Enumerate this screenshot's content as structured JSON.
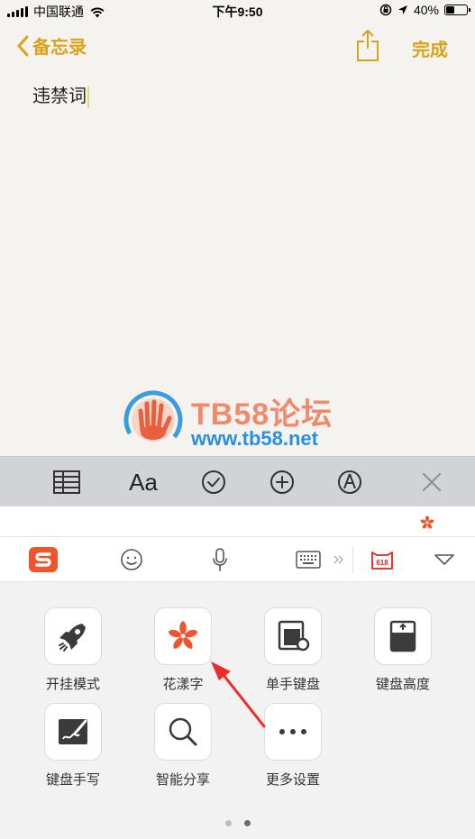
{
  "status": {
    "carrier": "中国联通",
    "time": "下午9:50",
    "battery": "40%"
  },
  "nav": {
    "back_label": "备忘录",
    "done_label": "完成"
  },
  "note": {
    "text": "违禁词"
  },
  "watermark": {
    "title": "TB58论坛",
    "url": "www.tb58.net"
  },
  "format_toolbar": {
    "text_style_label": "Aa"
  },
  "keyboard_toolbar": {
    "badge_label": "618"
  },
  "panel": {
    "tiles": [
      {
        "label": "开挂模式",
        "icon": "rocket-icon"
      },
      {
        "label": "花漾字",
        "icon": "flower-icon"
      },
      {
        "label": "单手键盘",
        "icon": "one-hand-keyboard-icon"
      },
      {
        "label": "键盘高度",
        "icon": "keyboard-height-icon"
      },
      {
        "label": "键盘手写",
        "icon": "handwriting-icon"
      },
      {
        "label": "智能分享",
        "icon": "search-icon"
      },
      {
        "label": "更多设置",
        "icon": "more-icon"
      }
    ],
    "page_indicator": {
      "pages": 2,
      "current": 2
    }
  },
  "colors": {
    "accent": "#d9a31a",
    "sogou_orange": "#f0542c",
    "annotation_red": "#ee2b2b"
  }
}
